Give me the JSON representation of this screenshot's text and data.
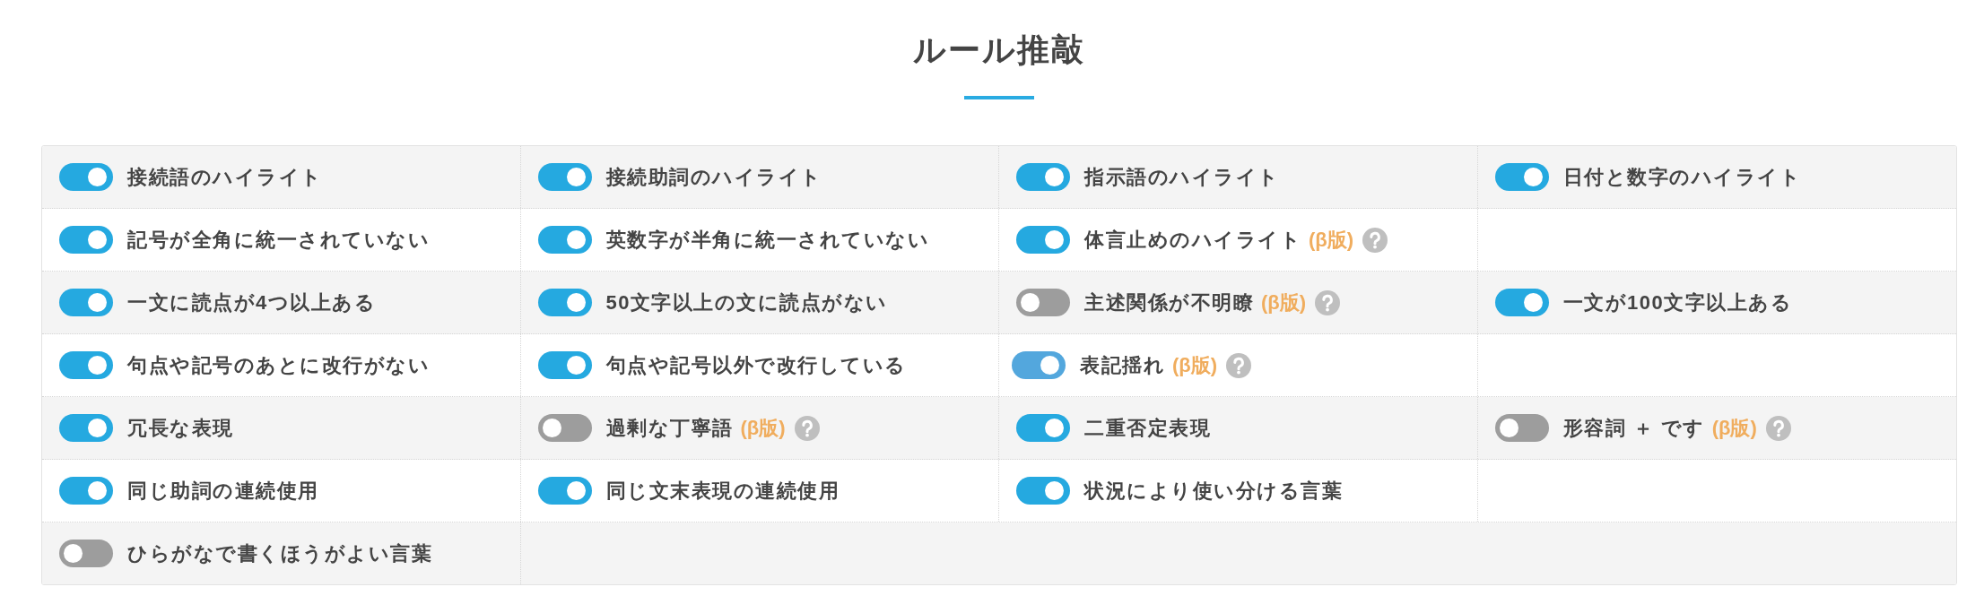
{
  "title": "ルール推敲",
  "rules": {
    "rows": [
      {
        "items": [
          {
            "kind": "plain",
            "label": "接続語のハイライト",
            "on": true,
            "hovered": false
          },
          {
            "kind": "plain",
            "label": "接続助詞のハイライト",
            "on": true,
            "hovered": false
          },
          {
            "kind": "plain",
            "label": "指示語のハイライト",
            "on": true,
            "hovered": false
          },
          {
            "kind": "plain",
            "label": "日付と数字のハイライト",
            "on": true,
            "hovered": false
          }
        ]
      },
      {
        "items": [
          {
            "kind": "plain",
            "label": "記号が全角に統一されていない",
            "on": true,
            "hovered": false
          },
          {
            "kind": "plain",
            "label": "英数字が半角に統一されていない",
            "on": true,
            "hovered": false
          },
          {
            "kind": "beta",
            "label": "体言止めのハイライト",
            "badge": "(β版)",
            "on": true,
            "hovered": false
          }
        ]
      },
      {
        "items": [
          {
            "kind": "plain",
            "label": "一文に読点が4つ以上ある",
            "on": true,
            "hovered": false
          },
          {
            "kind": "plain",
            "label": "50文字以上の文に読点がない",
            "on": true,
            "hovered": false
          },
          {
            "kind": "beta",
            "label": "主述関係が不明瞭",
            "badge": "(β版)",
            "on": false,
            "hovered": false
          },
          {
            "kind": "plain",
            "label": "一文が100文字以上ある",
            "on": true,
            "hovered": false
          }
        ]
      },
      {
        "items": [
          {
            "kind": "plain",
            "label": "句点や記号のあとに改行がない",
            "on": true,
            "hovered": false
          },
          {
            "kind": "plain",
            "label": "句点や記号以外で改行している",
            "on": true,
            "hovered": false
          },
          {
            "kind": "beta",
            "label": "表記揺れ",
            "badge": "(β版)",
            "on": true,
            "hovered": true
          }
        ]
      },
      {
        "items": [
          {
            "kind": "plain",
            "label": "冗長な表現",
            "on": true,
            "hovered": false
          },
          {
            "kind": "beta",
            "label": "過剰な丁寧語",
            "badge": "(β版)",
            "on": false,
            "hovered": false
          },
          {
            "kind": "plain",
            "label": "二重否定表現",
            "on": true,
            "hovered": false
          },
          {
            "kind": "beta",
            "label": "形容詞 ＋ です",
            "badge": "(β版)",
            "on": false,
            "hovered": false
          }
        ]
      },
      {
        "items": [
          {
            "kind": "plain",
            "label": "同じ助詞の連続使用",
            "on": true,
            "hovered": false
          },
          {
            "kind": "plain",
            "label": "同じ文末表現の連続使用",
            "on": true,
            "hovered": false
          },
          {
            "kind": "plain",
            "label": "状況により使い分ける言葉",
            "on": true,
            "hovered": false
          }
        ]
      },
      {
        "items": [
          {
            "kind": "plain",
            "label": "ひらがなで書くほうがよい言葉",
            "on": false,
            "hovered": false
          }
        ]
      }
    ]
  }
}
